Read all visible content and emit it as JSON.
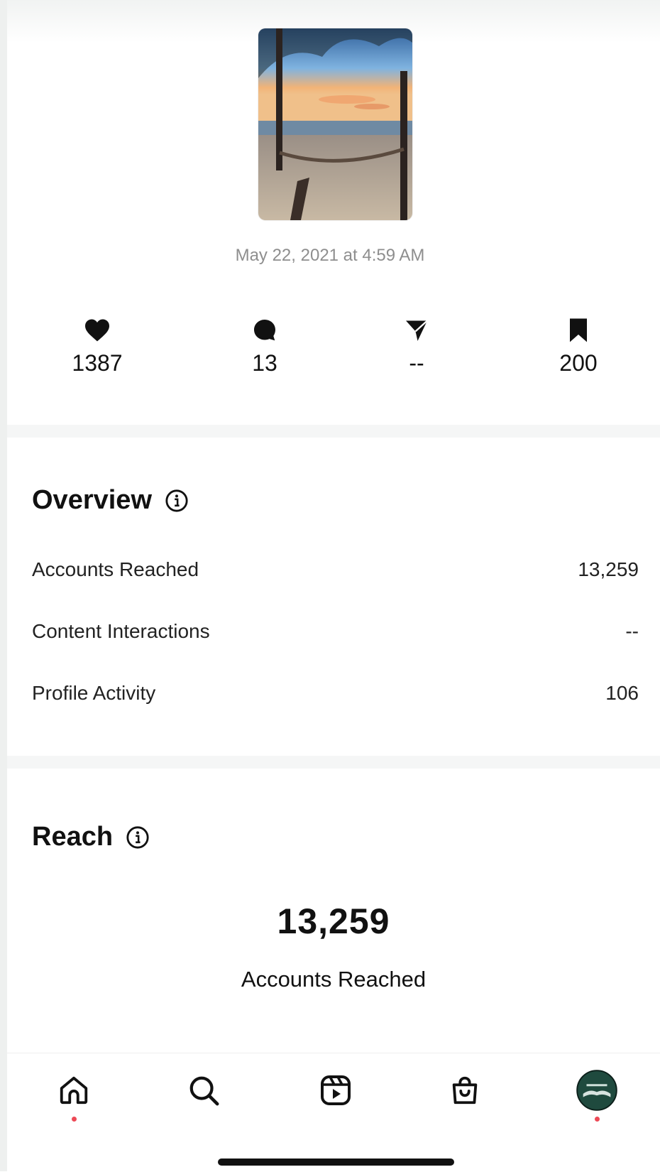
{
  "post": {
    "timestamp": "May 22, 2021 at 4:59 AM"
  },
  "stats": [
    {
      "icon": "heart-icon",
      "value": "1387"
    },
    {
      "icon": "comment-icon",
      "value": "13"
    },
    {
      "icon": "share-icon",
      "value": "--"
    },
    {
      "icon": "bookmark-icon",
      "value": "200"
    }
  ],
  "overview": {
    "title": "Overview",
    "rows": [
      {
        "label": "Accounts Reached",
        "value": "13,259"
      },
      {
        "label": "Content Interactions",
        "value": "--"
      },
      {
        "label": "Profile Activity",
        "value": "106"
      }
    ]
  },
  "reach": {
    "title": "Reach",
    "value": "13,259",
    "label": "Accounts Reached"
  },
  "nav": {
    "items": [
      "home-icon",
      "search-icon",
      "reels-icon",
      "shop-icon",
      "profile-avatar"
    ],
    "notification_color": "#ed4956"
  }
}
